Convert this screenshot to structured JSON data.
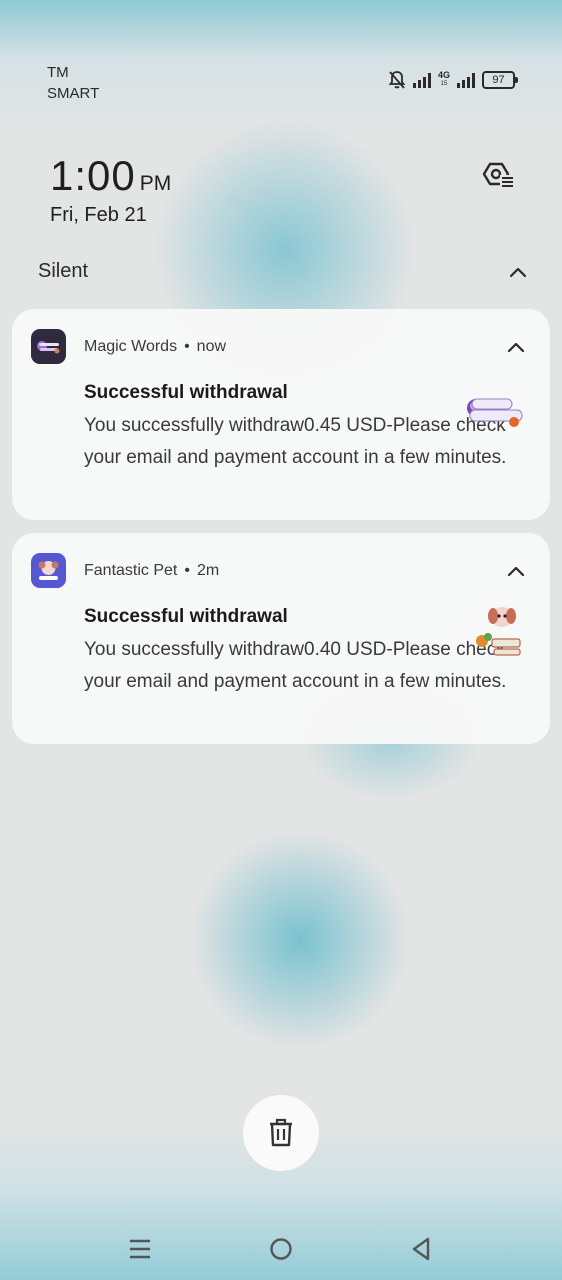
{
  "status_bar": {
    "carrier_line1": "TM",
    "carrier_line2": "SMART",
    "network": "4G",
    "network_sub": "15",
    "battery": "97",
    "icons": [
      "bell-off-icon",
      "signal-icon",
      "signal-icon",
      "battery-icon"
    ]
  },
  "clock": {
    "time": "1:00",
    "ampm": "PM",
    "date": "Fri, Feb 21"
  },
  "section": {
    "title": "Silent"
  },
  "notifications": [
    {
      "app": "Magic Words",
      "separator": "•",
      "time": "now",
      "title": "Successful withdrawal",
      "body": "You successfully withdraw0.45 USD-Please check your email and payment account in a few minutes.",
      "icon_color": "#3b3450"
    },
    {
      "app": "Fantastic Pet",
      "separator": "•",
      "time": "2m",
      "title": "Successful withdrawal",
      "body": "You successfully withdraw0.40 USD-Please check your email and payment account in a few minutes.",
      "icon_color": "#5b5fd6"
    }
  ],
  "colors": {
    "accent": "#7cc3cf",
    "card": "#f8f8f8",
    "text": "#1b1b1b"
  }
}
